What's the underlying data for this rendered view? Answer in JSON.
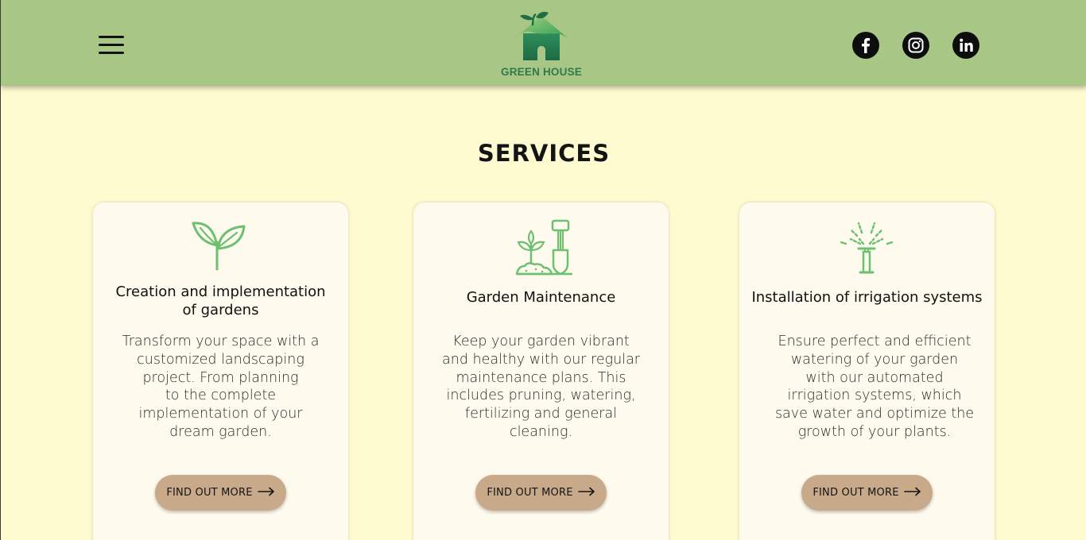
{
  "header": {
    "menu_icon": "hamburger-menu-icon",
    "logo_text": "GREEN HOUSE",
    "social": [
      {
        "name": "facebook-icon",
        "label": "f"
      },
      {
        "name": "instagram-icon",
        "label": ""
      },
      {
        "name": "linkedin-icon",
        "label": "in"
      }
    ]
  },
  "services": {
    "title": "SERVICES",
    "cards": [
      {
        "icon": "sprout-icon",
        "title_lines": [
          "Creation and implementation",
          "of gardens"
        ],
        "desc_lines": [
          "Transform your space with a",
          "customized landscaping",
          "project. From planning",
          "to the complete",
          "implementation of your",
          "dream garden."
        ],
        "cta": "FIND OUT MORE"
      },
      {
        "icon": "shovel-plant-icon",
        "title_lines": [
          "Garden Maintenance"
        ],
        "desc_lines": [
          "Keep your garden vibrant",
          "and healthy with our regular",
          "maintenance plans. This",
          "includes pruning, watering,",
          "fertilizing and general",
          "cleaning."
        ],
        "cta": "FIND OUT MORE"
      },
      {
        "icon": "sprinkler-icon",
        "title_lines": [
          "Installation of irrigation systems"
        ],
        "desc_lines": [
          "Ensure perfect and efficient",
          "watering of your garden",
          "with our automated",
          "irrigation systems, which",
          "save water and optimize the",
          "growth of your plants."
        ],
        "cta": "FIND OUT MORE"
      }
    ]
  },
  "colors": {
    "header_bg": "#a8c786",
    "page_bg": "#fefbd0",
    "card_bg": "#fefaee",
    "button_bg": "#c8a98a",
    "icon_green": "#6cc070",
    "logo_green": "#2f7a4a"
  }
}
